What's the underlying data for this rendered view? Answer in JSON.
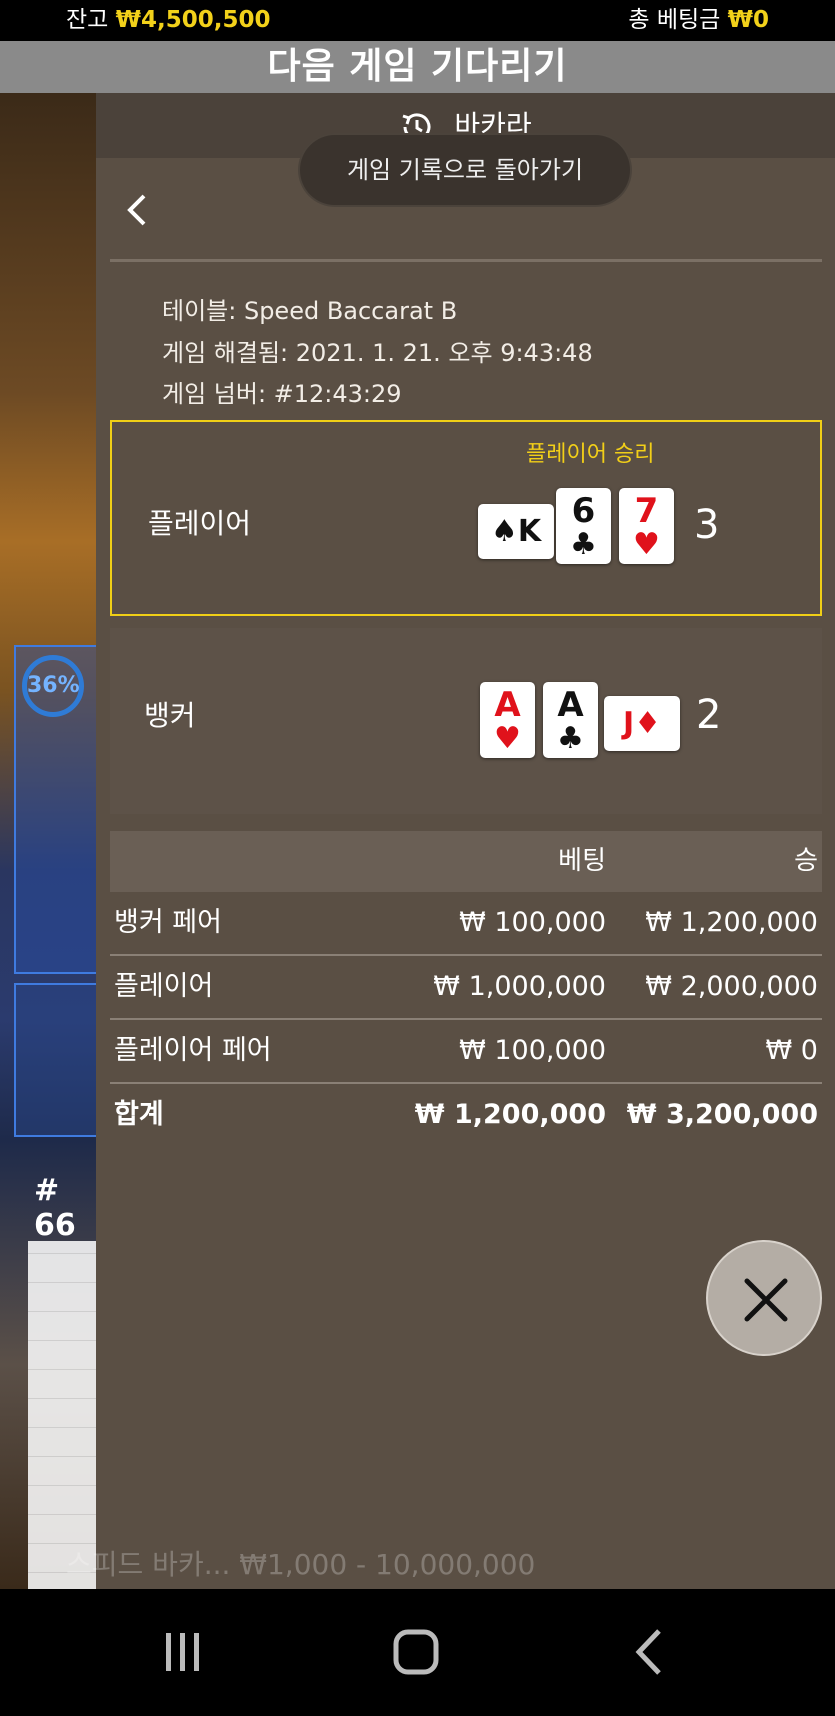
{
  "status_bar": {
    "balance_label": "잔고",
    "balance_value": "₩4,500,500",
    "total_bet_label": "총 베팅금",
    "total_bet_value": "₩0"
  },
  "waiting_banner": "다음 게임 기다리기",
  "panel": {
    "header_title": "바카라",
    "back_button_label": "게임 기록으로 돌아가기",
    "info": {
      "table": "테이블: Speed Baccarat B",
      "resolved": "게임 해결됨: 2021. 1. 21. 오후 9:43:48",
      "game_number": "게임 넘버: #12:43:29"
    },
    "player": {
      "label": "플레이어",
      "win_label": "플레이어 승리",
      "score": "3",
      "cards": [
        {
          "rank": "K",
          "suit": "♠",
          "color": "#111111",
          "orientation": "horizontal"
        },
        {
          "rank": "6",
          "suit": "♣",
          "color": "#111111",
          "orientation": "vertical"
        },
        {
          "rank": "7",
          "suit": "♥",
          "color": "#e0121b",
          "orientation": "vertical"
        }
      ]
    },
    "banker": {
      "label": "뱅커",
      "score": "2",
      "cards": [
        {
          "rank": "A",
          "suit": "♥",
          "color": "#e0121b",
          "orientation": "vertical"
        },
        {
          "rank": "A",
          "suit": "♣",
          "color": "#111111",
          "orientation": "vertical"
        },
        {
          "rank": "J",
          "suit": "♦",
          "color": "#e0121b",
          "orientation": "horizontal"
        }
      ]
    },
    "bets_table": {
      "header_bet": "베팅",
      "header_win": "승",
      "rows": [
        {
          "name": "뱅커 페어",
          "bet": "₩ 100,000",
          "win": "₩ 1,200,000"
        },
        {
          "name": "플레이어",
          "bet": "₩ 1,000,000",
          "win": "₩ 2,000,000"
        },
        {
          "name": "플레이어 페어",
          "bet": "₩ 100,000",
          "win": "₩ 0"
        }
      ],
      "total": {
        "name": "합계",
        "bet": "₩ 1,200,000",
        "win": "₩ 3,200,000"
      }
    }
  },
  "background": {
    "percent_badge": "36%",
    "table_number": "# 66",
    "ghost_text": "스피드 바카... ₩1,000 - 10,000,000"
  },
  "colors": {
    "accent_gold": "#f2d11a",
    "win_border": "#f0cf16",
    "panel_bg": "#5a4f44"
  }
}
